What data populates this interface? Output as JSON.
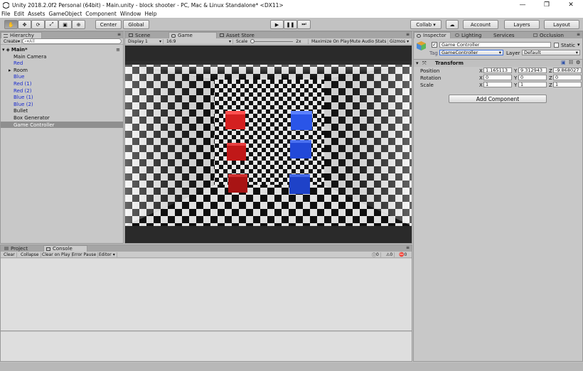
{
  "window": {
    "title": "Unity 2018.2.0f2 Personal (64bit) - Main.unity - block shooter - PC, Mac & Linux Standalone* <DX11>",
    "min": "—",
    "max": "❐",
    "close": "✕"
  },
  "menu": [
    "File",
    "Edit",
    "Assets",
    "GameObject",
    "Component",
    "Window",
    "Help"
  ],
  "toolbar": {
    "center": "Center",
    "global": "Global",
    "collab": "Collab ▾",
    "account": "Account",
    "layers": "Layers",
    "layout": "Layout"
  },
  "hierarchy": {
    "tab": "Hierarchy",
    "create": "Create",
    "search_placeholder": "▾All",
    "scene": "Main*",
    "items": [
      {
        "label": "Main Camera",
        "blue": false,
        "selected": false,
        "expander": false
      },
      {
        "label": "Red",
        "blue": true,
        "selected": false,
        "expander": false
      },
      {
        "label": "Room",
        "blue": false,
        "selected": false,
        "expander": true
      },
      {
        "label": "Blue",
        "blue": true,
        "selected": false,
        "expander": false
      },
      {
        "label": "Red (1)",
        "blue": true,
        "selected": false,
        "expander": false
      },
      {
        "label": "Red (2)",
        "blue": true,
        "selected": false,
        "expander": false
      },
      {
        "label": "Blue (1)",
        "blue": true,
        "selected": false,
        "expander": false
      },
      {
        "label": "Blue (2)",
        "blue": true,
        "selected": false,
        "expander": false
      },
      {
        "label": "Bullet",
        "blue": false,
        "selected": false,
        "expander": false
      },
      {
        "label": "Box Generator",
        "blue": false,
        "selected": false,
        "expander": false
      },
      {
        "label": "Game Controller",
        "blue": false,
        "selected": true,
        "expander": false
      }
    ]
  },
  "center_tabs": {
    "scene": "Scene",
    "game": "Game",
    "asset_store": "Asset Store",
    "display": "Display 1",
    "aspect": "16:9",
    "scale_label": "Scale",
    "scale_value": "2x",
    "maximize": "Maximize On Play",
    "mute": "Mute Audio",
    "stats": "Stats",
    "gizmos": "Gizmos"
  },
  "bottom": {
    "project_tab": "Project",
    "console_tab": "Console",
    "clear": "Clear",
    "collapse": "Collapse",
    "clear_on_play": "Clear on Play",
    "error_pause": "Error Pause",
    "editor": "Editor",
    "count_info": "0",
    "count_warn": "0",
    "count_err": "0"
  },
  "inspector": {
    "tabs": [
      "Inspector",
      "Lighting",
      "Services",
      "Occlusion"
    ],
    "object_name": "Game Controller",
    "static_label": "Static",
    "tag_label": "Tag",
    "tag_value": "GameController",
    "layer_label": "Layer",
    "layer_value": "Default",
    "transform_title": "Transform",
    "rows": [
      {
        "label": "Position",
        "x": "1.165113",
        "y": "9.312943",
        "z": "-9.868027"
      },
      {
        "label": "Rotation",
        "x": "0",
        "y": "0",
        "z": "0"
      },
      {
        "label": "Scale",
        "x": "1",
        "y": "1",
        "z": "1"
      }
    ],
    "add_component": "Add Component"
  },
  "colors": {
    "selection": "#8f8f8f",
    "red_cube": "#d42020",
    "blue_cube": "#2a55e8"
  }
}
